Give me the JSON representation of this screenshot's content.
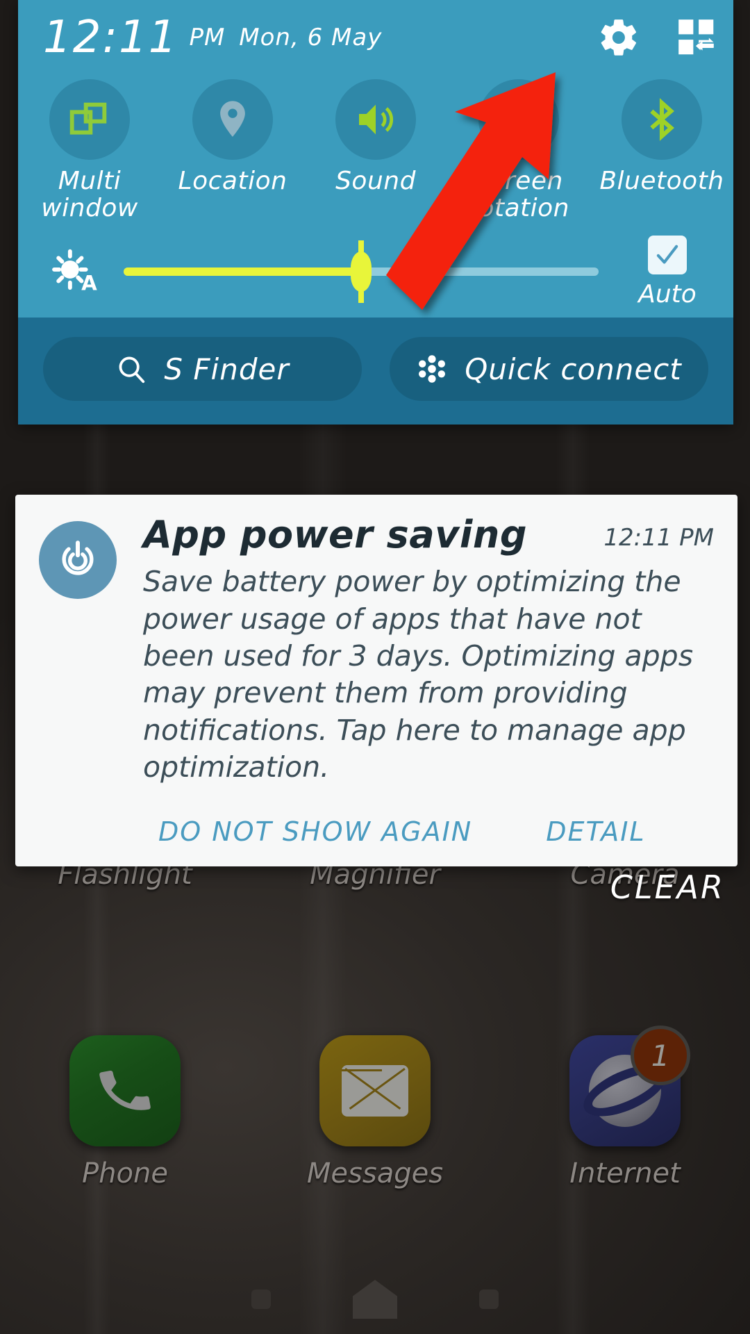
{
  "status_bar": {
    "time": "12:11",
    "ampm": "PM",
    "date": "Mon, 6 May",
    "settings_icon": "gear-icon",
    "edit_icon": "quick-settings-edit-icon"
  },
  "quick_settings": {
    "toggles": [
      {
        "label": "Multi\nwindow",
        "icon": "multi-window-icon",
        "active": true
      },
      {
        "label": "Location",
        "icon": "location-pin-icon",
        "active": false
      },
      {
        "label": "Sound",
        "icon": "sound-speaker-icon",
        "active": true
      },
      {
        "label": "Screen\nrotation",
        "icon": "screen-rotation-icon",
        "active": true
      },
      {
        "label": "Bluetooth",
        "icon": "bluetooth-icon",
        "active": true
      }
    ],
    "brightness": {
      "icon": "brightness-auto-icon",
      "value": 50,
      "auto_label": "Auto",
      "auto_checked": true
    },
    "shortcuts": [
      {
        "label": "S Finder",
        "icon": "search-icon"
      },
      {
        "label": "Quick connect",
        "icon": "quick-connect-icon"
      }
    ]
  },
  "notification": {
    "icon": "power-saving-icon",
    "title": "App power saving",
    "time": "12:11 PM",
    "body": "Save battery power by optimizing the power usage of apps that have not been used for 3 days. Optimizing apps may prevent them from providing notifications. Tap here to manage app optimization.",
    "actions": [
      "DO NOT SHOW AGAIN",
      "DETAIL"
    ]
  },
  "clear_label": "CLEAR",
  "home_screen": {
    "row1": [
      {
        "label": "Flashlight",
        "icon": "flashlight-app-icon"
      },
      {
        "label": "Magnifier",
        "icon": "magnifier-app-icon"
      },
      {
        "label": "Camera",
        "icon": "camera-app-icon"
      }
    ],
    "row2": [
      {
        "label": "Phone",
        "icon": "phone-app-icon",
        "badge": ""
      },
      {
        "label": "Messages",
        "icon": "messages-app-icon",
        "badge": ""
      },
      {
        "label": "Internet",
        "icon": "internet-app-icon",
        "badge": "1"
      }
    ]
  },
  "nav_bar": {
    "recents": "recents-button",
    "home": "home-button",
    "back": "back-button"
  },
  "colors": {
    "panel_light": "#3b9cbd",
    "panel_dark": "#1d6d91",
    "accent_green": "#9ed227",
    "accent_yellow": "#e8f53a",
    "notif_link": "#4a9bc0",
    "arrow_red": "#f42310"
  }
}
